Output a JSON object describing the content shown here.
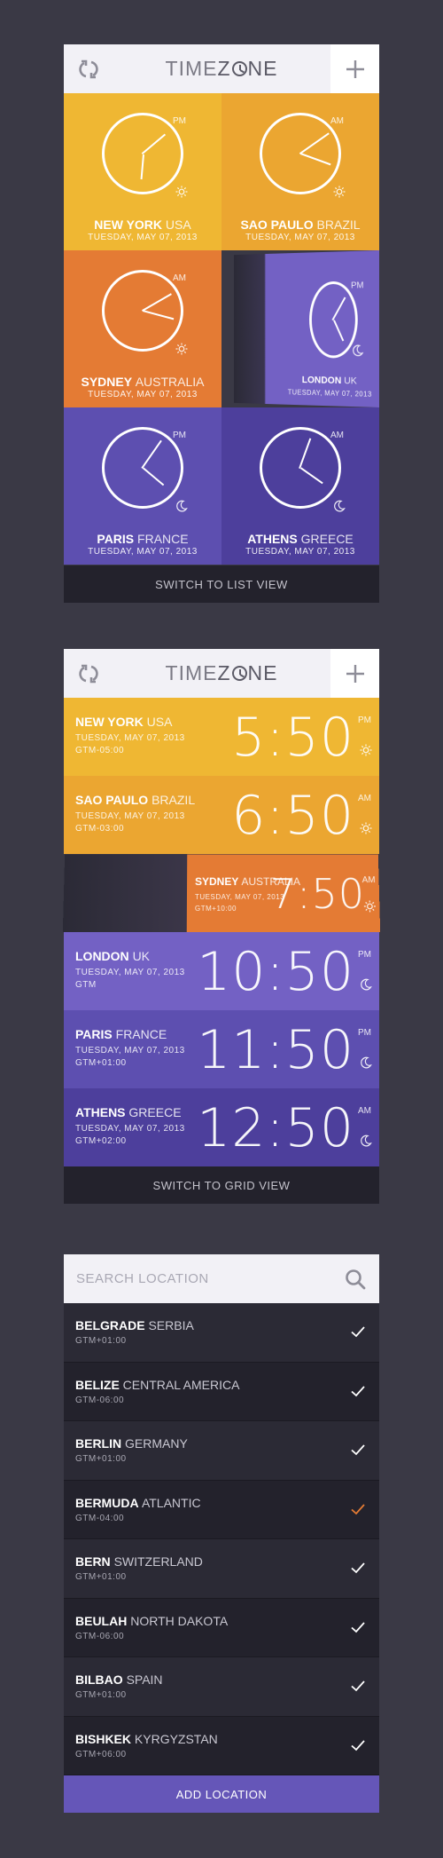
{
  "header": {
    "logo_light": "TIME",
    "logo_bold": "Z",
    "logo_rest": "NE"
  },
  "grid": {
    "tiles": [
      {
        "city": "NEW YORK",
        "country": "USA",
        "date": "TUESDAY, MAY 07, 2013",
        "ampm": "PM",
        "weather_icon": "sun-icon",
        "color": "#efb733"
      },
      {
        "city": "SAO PAULO",
        "country": "BRAZIL",
        "date": "TUESDAY, MAY 07, 2013",
        "ampm": "AM",
        "weather_icon": "sun-icon",
        "color": "#eba631"
      },
      {
        "city": "SYDNEY",
        "country": "AUSTRALIA",
        "date": "TUESDAY, MAY 07, 2013",
        "ampm": "AM",
        "weather_icon": "sun-icon",
        "color": "#e47b34"
      },
      {
        "city": "LONDON",
        "country": "UK",
        "date": "TUESDAY, MAY 07, 2013",
        "ampm": "PM",
        "weather_icon": "moon-icon",
        "color": "#7361c4"
      },
      {
        "city": "PARIS",
        "country": "FRANCE",
        "date": "TUESDAY, MAY 07, 2013",
        "ampm": "PM",
        "weather_icon": "moon-icon",
        "color": "#5d4fb0"
      },
      {
        "city": "ATHENS",
        "country": "GREECE",
        "date": "TUESDAY, MAY 07, 2013",
        "ampm": "AM",
        "weather_icon": "moon-icon",
        "color": "#4d3f9c"
      }
    ],
    "switch_label": "SWITCH TO LIST VIEW"
  },
  "list": {
    "rows": [
      {
        "city": "NEW YORK",
        "country": "USA",
        "date": "TUESDAY, MAY 07, 2013",
        "gmt": "GTM-05:00",
        "time": "5:50",
        "ampm": "PM",
        "weather_icon": "sun-icon",
        "color": "#efb733"
      },
      {
        "city": "SAO PAULO",
        "country": "BRAZIL",
        "date": "TUESDAY, MAY 07, 2013",
        "gmt": "GTM-03:00",
        "time": "6:50",
        "ampm": "AM",
        "weather_icon": "sun-icon",
        "color": "#eba631"
      },
      {
        "city": "SYDNEY",
        "country": "AUSTRALIA",
        "date": "TUESDAY, MAY 07, 2013",
        "gmt": "GTM+10:00",
        "time": "7:50",
        "ampm": "AM",
        "weather_icon": "sun-icon",
        "color": "#e47b34"
      },
      {
        "city": "LONDON",
        "country": "UK",
        "date": "TUESDAY, MAY 07, 2013",
        "gmt": "GTM",
        "time": "10:50",
        "ampm": "PM",
        "weather_icon": "moon-icon",
        "color": "#7361c4"
      },
      {
        "city": "PARIS",
        "country": "FRANCE",
        "date": "TUESDAY, MAY 07, 2013",
        "gmt": "GTM+01:00",
        "time": "11:50",
        "ampm": "PM",
        "weather_icon": "moon-icon",
        "color": "#5d4fb0"
      },
      {
        "city": "ATHENS",
        "country": "GREECE",
        "date": "TUESDAY, MAY 07, 2013",
        "gmt": "GTM+02:00",
        "time": "12:50",
        "ampm": "AM",
        "weather_icon": "moon-icon",
        "color": "#4d3f9c"
      }
    ],
    "switch_label": "SWITCH TO GRID VIEW"
  },
  "search": {
    "placeholder": "SEARCH LOCATION",
    "results": [
      {
        "city": "BELGRADE",
        "country": "SERBIA",
        "gmt": "GTM+01:00",
        "selected": false
      },
      {
        "city": "BELIZE",
        "country": "CENTRAL AMERICA",
        "gmt": "GTM-06:00",
        "selected": false
      },
      {
        "city": "BERLIN",
        "country": "GERMANY",
        "gmt": "GTM+01:00",
        "selected": false
      },
      {
        "city": "BERMUDA",
        "country": "ATLANTIC",
        "gmt": "GTM-04:00",
        "selected": true
      },
      {
        "city": "BERN",
        "country": "SWITZERLAND",
        "gmt": "GTM+01:00",
        "selected": false
      },
      {
        "city": "BEULAH",
        "country": "NORTH DAKOTA",
        "gmt": "GTM-06:00",
        "selected": false
      },
      {
        "city": "BILBAO",
        "country": "SPAIN",
        "gmt": "GTM+01:00",
        "selected": false
      },
      {
        "city": "BISHKEK",
        "country": "KYRGYZSTAN",
        "gmt": "GTM+06:00",
        "selected": false
      }
    ],
    "add_label": "ADD LOCATION",
    "colors": {
      "row_dark": "#23222c",
      "row_light": "#2b2a35",
      "check": "#ffffff",
      "check_selected": "#e47b34"
    }
  }
}
